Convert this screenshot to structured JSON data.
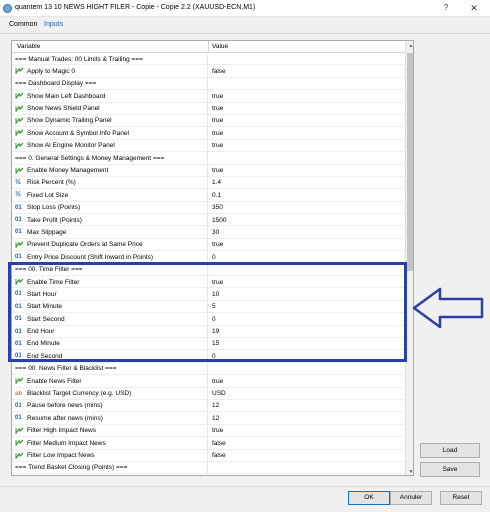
{
  "window": {
    "title": "quantem 13 10 NEWS HIGHT FILER - Copie - Copie 2.2 (XAUUSD-ECN,M1)",
    "help": "?",
    "close": "✕"
  },
  "tabs": [
    {
      "label": "Common"
    },
    {
      "label": "Inputs"
    }
  ],
  "grid": {
    "col_variable": "Variable",
    "col_value": "Value"
  },
  "rows": [
    {
      "type": "sep",
      "label": "=== Manual Trades: 00 Limits & Trailing ===",
      "value": ""
    },
    {
      "type": "bool",
      "label": "Apply to Magic 0",
      "value": "false"
    },
    {
      "type": "sep",
      "label": "=== Dashboard Display ===",
      "value": ""
    },
    {
      "type": "bool",
      "label": "Show Main Left Dashboard",
      "value": "true"
    },
    {
      "type": "bool",
      "label": "Show News Shield Panel",
      "value": "true"
    },
    {
      "type": "bool",
      "label": "Show Dynamic Trailing Panel",
      "value": "true"
    },
    {
      "type": "bool",
      "label": "Show Account & Symbol Info Panel",
      "value": "true"
    },
    {
      "type": "bool",
      "label": "Show AI Engine Monitor Panel",
      "value": "true"
    },
    {
      "type": "sep",
      "label": "=== 0. General Settings & Money Management ===",
      "value": ""
    },
    {
      "type": "bool",
      "label": "Enable Money Management",
      "value": "true"
    },
    {
      "type": "dbl",
      "label": "Risk Percent (%)",
      "value": "1.4"
    },
    {
      "type": "dbl",
      "label": "Fixed Lot Size",
      "value": "0.1"
    },
    {
      "type": "int",
      "label": "Stop Loss (Points)",
      "value": "350"
    },
    {
      "type": "int",
      "label": "Take Profit (Points)",
      "value": "1500"
    },
    {
      "type": "int",
      "label": "Max Slippage",
      "value": "30"
    },
    {
      "type": "bool",
      "label": "Prevent Duplicate Orders at Same Price",
      "value": "true"
    },
    {
      "type": "int",
      "label": "Entry Price Discount (Shift Inward in Points)",
      "value": "0"
    },
    {
      "type": "sep",
      "label": "=== 00. Time Filter ===",
      "value": ""
    },
    {
      "type": "bool",
      "label": "Enable Time Filter",
      "value": "true"
    },
    {
      "type": "int",
      "label": "Start Hour",
      "value": "10"
    },
    {
      "type": "int",
      "label": "Start Minute",
      "value": "5"
    },
    {
      "type": "int",
      "label": "Start Second",
      "value": "0"
    },
    {
      "type": "int",
      "label": "End Hour",
      "value": "19"
    },
    {
      "type": "int",
      "label": "End Minute",
      "value": "15"
    },
    {
      "type": "int",
      "label": "End Second",
      "value": "0"
    },
    {
      "type": "sep",
      "label": "=== 00. News Filter & Blacklist ===",
      "value": ""
    },
    {
      "type": "bool",
      "label": "Enable News Filter",
      "value": "true"
    },
    {
      "type": "str",
      "label": "Blacklist Target Currency (e.g. USD)",
      "value": "USD"
    },
    {
      "type": "int",
      "label": "Pause before news (mins)",
      "value": "12"
    },
    {
      "type": "int",
      "label": "Resume after news (mins)",
      "value": "12"
    },
    {
      "type": "bool",
      "label": "Filter High Impact News",
      "value": "true"
    },
    {
      "type": "bool",
      "label": "Filter Medium Impact News",
      "value": "false"
    },
    {
      "type": "bool",
      "label": "Filter Low Impact News",
      "value": "false"
    },
    {
      "type": "sep",
      "label": "=== Trend Basket Closing (Points) ===",
      "value": ""
    }
  ],
  "icons": {
    "int": "01",
    "dbl": "½",
    "str": "ab"
  },
  "side_buttons": {
    "load": "Load",
    "save": "Save"
  },
  "footer": {
    "ok": "OK",
    "cancel": "Annuler",
    "reset": "Reset"
  },
  "colors": {
    "highlight": "#2b3fa8",
    "accent": "#1e63b4",
    "bool_icon": "#3a9a3a"
  }
}
